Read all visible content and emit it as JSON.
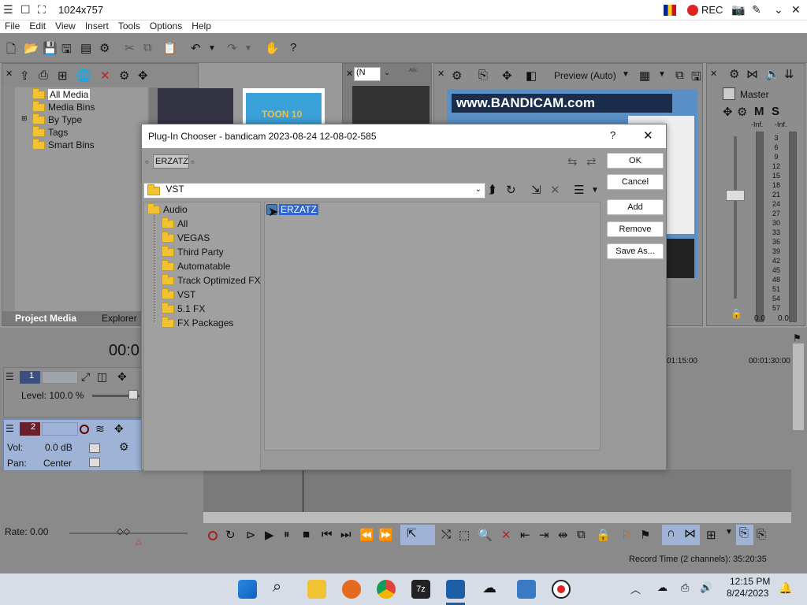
{
  "window": {
    "title": "1024x757",
    "rec_label": "REC"
  },
  "menu": [
    "File",
    "Edit",
    "View",
    "Insert",
    "Tools",
    "Options",
    "Help"
  ],
  "project_media": {
    "tree": [
      "All Media",
      "Media Bins",
      "By Type",
      "Tags",
      "Smart Bins"
    ],
    "tabs": [
      "Project Media",
      "Explorer"
    ]
  },
  "preview": {
    "mode": "Preview (Auto)",
    "select_value": "(N"
  },
  "mixer": {
    "title": "Master",
    "meter_labels": [
      "3",
      "6",
      "9",
      "12",
      "15",
      "18",
      "21",
      "24",
      "27",
      "30",
      "33",
      "36",
      "39",
      "42",
      "45",
      "48",
      "51",
      "54",
      "57"
    ],
    "inf_left": "-Inf.",
    "inf_right": "-Inf.",
    "level_left": "0.0",
    "level_right": "0.0"
  },
  "timeline": {
    "time_display": "00:0",
    "ruler": [
      "01:15:00",
      "00:01:30:00"
    ],
    "track1": {
      "num": "1",
      "level": "Level: 100.0 %"
    },
    "track2": {
      "num": "2",
      "vol_label": "Vol:",
      "vol_value": "0.0 dB",
      "pan_label": "Pan:",
      "pan_value": "Center"
    },
    "rate": "Rate: 0.00",
    "record_time": "Record Time (2 channels): 35:20:35"
  },
  "dialog": {
    "title": "Plug-In Chooser - bandicam 2023-08-24 12-08-02-585",
    "help": "?",
    "close": "✕",
    "chain_label": "ERZATZ",
    "path": "VST",
    "buttons": {
      "ok": "OK",
      "cancel": "Cancel",
      "add": "Add",
      "remove": "Remove",
      "save_as": "Save As..."
    },
    "tree": [
      "Audio",
      "All",
      "VEGAS",
      "Third Party",
      "Automatable",
      "Track Optimized FX",
      "VST",
      "5.1 FX",
      "FX Packages"
    ],
    "list_items": [
      "ERZATZ"
    ]
  },
  "thumbs": {
    "bandicam_text": "www.BANDICAM.com",
    "toon_text": "TOON 10"
  },
  "taskbar": {
    "time": "12:15 PM",
    "date": "8/24/2023"
  }
}
